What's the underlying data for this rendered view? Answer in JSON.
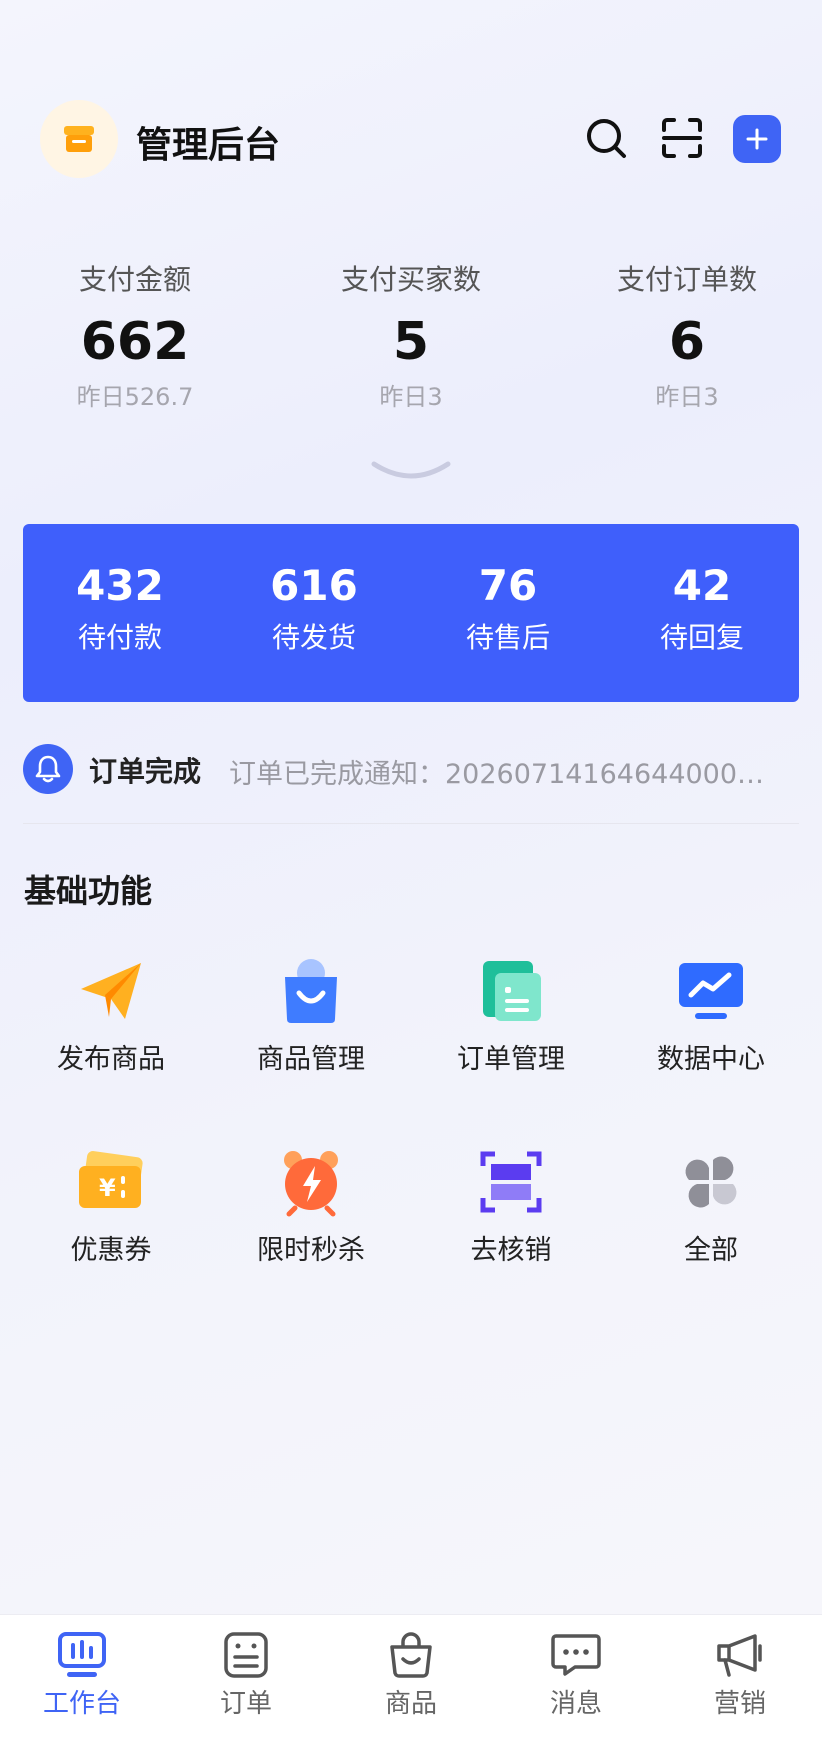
{
  "header": {
    "title": "管理后台",
    "logo_icon": "store-icon",
    "search_icon": "search-icon",
    "scan_icon": "scan-icon",
    "add_icon": "plus-icon",
    "accent_color": "#3f64f5"
  },
  "stats": [
    {
      "label": "支付金额",
      "value": "662",
      "yesterday": "昨日526.7"
    },
    {
      "label": "支付买家数",
      "value": "5",
      "yesterday": "昨日3"
    },
    {
      "label": "支付订单数",
      "value": "6",
      "yesterday": "昨日3"
    }
  ],
  "order_panel": {
    "color": "#3f5ffb",
    "items": [
      {
        "value": "432",
        "label": "待付款"
      },
      {
        "value": "616",
        "label": "待发货"
      },
      {
        "value": "76",
        "label": "待售后"
      },
      {
        "value": "42",
        "label": "待回复"
      }
    ]
  },
  "notice": {
    "title": "订单完成",
    "text": "订单已完成通知：20260714164644000…",
    "icon": "bell-icon"
  },
  "basic_functions": {
    "title": "基础功能",
    "items": [
      {
        "label": "发布商品",
        "icon": "paper-plane-icon"
      },
      {
        "label": "商品管理",
        "icon": "shopping-bag-icon"
      },
      {
        "label": "订单管理",
        "icon": "order-list-icon"
      },
      {
        "label": "数据中心",
        "icon": "data-monitor-icon"
      },
      {
        "label": "优惠券",
        "icon": "coupon-icon"
      },
      {
        "label": "限时秒杀",
        "icon": "alarm-flash-icon"
      },
      {
        "label": "去核销",
        "icon": "scan-verify-icon"
      },
      {
        "label": "全部",
        "icon": "grid-all-icon"
      }
    ]
  },
  "tabbar": {
    "active_color": "#3f64f5",
    "items": [
      {
        "label": "工作台",
        "icon": "dashboard-icon",
        "active": true
      },
      {
        "label": "订单",
        "icon": "order-icon",
        "active": false
      },
      {
        "label": "商品",
        "icon": "bag-icon",
        "active": false
      },
      {
        "label": "消息",
        "icon": "message-icon",
        "active": false
      },
      {
        "label": "营销",
        "icon": "megaphone-icon",
        "active": false
      }
    ]
  }
}
